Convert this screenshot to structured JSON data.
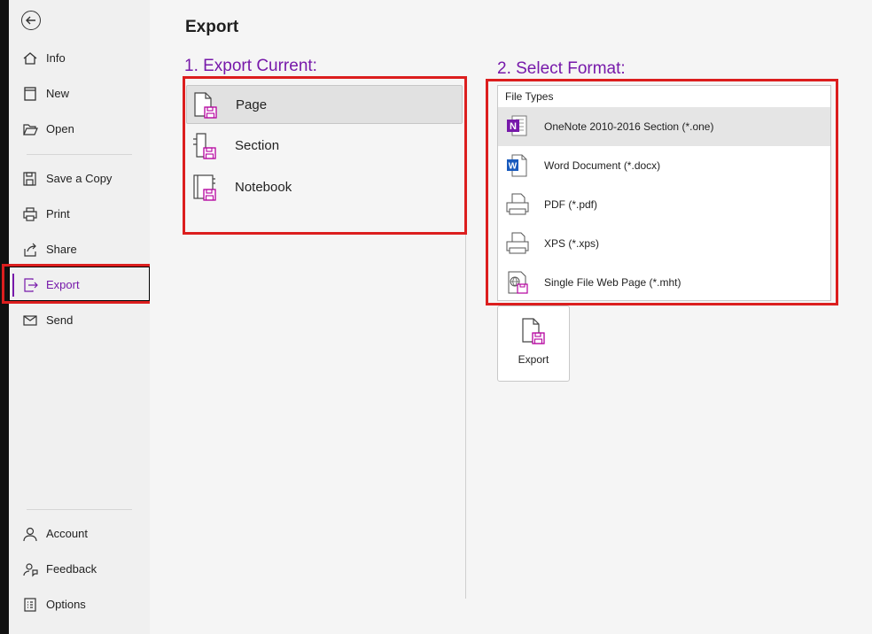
{
  "sidebar": {
    "items": [
      {
        "label": "Info"
      },
      {
        "label": "New"
      },
      {
        "label": "Open"
      },
      {
        "label": "Save a Copy"
      },
      {
        "label": "Print"
      },
      {
        "label": "Share"
      },
      {
        "label": "Export"
      },
      {
        "label": "Send"
      },
      {
        "label": "Account"
      },
      {
        "label": "Feedback"
      },
      {
        "label": "Options"
      }
    ],
    "active": "Export"
  },
  "main": {
    "title": "Export",
    "export_current": {
      "heading": "1. Export Current:",
      "options": [
        {
          "label": "Page"
        },
        {
          "label": "Section"
        },
        {
          "label": "Notebook"
        }
      ],
      "selected": "Page"
    },
    "select_format": {
      "heading": "2. Select Format:",
      "list_header": "File Types",
      "types": [
        {
          "label": "OneNote 2010-2016 Section (*.one)"
        },
        {
          "label": "Word Document (*.docx)"
        },
        {
          "label": "PDF (*.pdf)"
        },
        {
          "label": "XPS (*.xps)"
        },
        {
          "label": "Single File Web Page (*.mht)"
        }
      ],
      "selected": "OneNote 2010-2016 Section (*.one)"
    },
    "export_button": {
      "label": "Export"
    }
  },
  "colors": {
    "accent": "#7719aa",
    "highlight": "#dc1e1e",
    "word_blue": "#185abd",
    "onenote_purple": "#7719aa"
  }
}
